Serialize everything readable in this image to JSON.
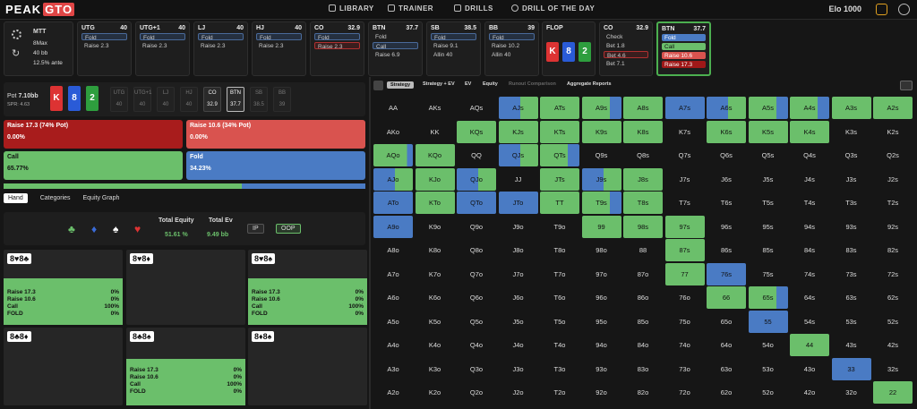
{
  "app": {
    "logo_a": "PEAK",
    "logo_b": "GTO",
    "elo": "Elo 1000"
  },
  "nav": [
    {
      "label": "LIBRARY",
      "icon": "library-icon"
    },
    {
      "label": "TRAINER",
      "icon": "trainer-icon"
    },
    {
      "label": "DRILLS",
      "icon": "drills-icon"
    },
    {
      "label": "DRILL OF THE DAY",
      "icon": "drill-day-icon"
    }
  ],
  "settings": {
    "format": "MTT",
    "max": "8Max",
    "stack": "40 bb",
    "ante": "12.5% ante"
  },
  "seats": [
    {
      "name": "UTG",
      "stack": "40",
      "actions": [
        "Fold",
        "Raise 2.3"
      ],
      "hl": 0
    },
    {
      "name": "UTG+1",
      "stack": "40",
      "actions": [
        "Fold",
        "Raise 2.3"
      ],
      "hl": 0
    },
    {
      "name": "LJ",
      "stack": "40",
      "actions": [
        "Fold",
        "Raise 2.3"
      ],
      "hl": 0
    },
    {
      "name": "HJ",
      "stack": "40",
      "actions": [
        "Fold",
        "Raise 2.3"
      ],
      "hl": 0
    },
    {
      "name": "CO",
      "stack": "32.9",
      "actions": [
        "Fold",
        "Raise 2.3"
      ],
      "hl": 1
    },
    {
      "name": "BTN",
      "stack": "37.7",
      "actions": [
        "Fold",
        "Call",
        "Raise 6.9"
      ],
      "hl": 1
    },
    {
      "name": "SB",
      "stack": "38.5",
      "actions": [
        "Fold",
        "Raise 9.1",
        "Allin 40"
      ],
      "hl": 0
    },
    {
      "name": "BB",
      "stack": "39",
      "actions": [
        "Fold",
        "Raise 10.2",
        "Allin 40"
      ],
      "hl": 0
    }
  ],
  "flop": {
    "name": "FLOP",
    "cards": [
      {
        "rank": "K",
        "color": "#d33"
      },
      {
        "rank": "8",
        "color": "#2a5bd7"
      },
      {
        "rank": "2",
        "color": "#2e9e3e"
      }
    ]
  },
  "co_seat": {
    "name": "CO",
    "stack": "32.9",
    "actions": [
      "Check",
      "Bet 1.8",
      "Bet 4.6",
      "Bet 7.1"
    ]
  },
  "btn_active": {
    "name": "BTN",
    "stack": "37.7",
    "actions": [
      "Fold",
      "Call",
      "Raise 10.6",
      "Raise 17.3"
    ]
  },
  "pot": {
    "label": "Pot",
    "value": "7.10bb",
    "spr": "SPR: 4.63",
    "board": [
      {
        "rank": "K",
        "color": "#d33"
      },
      {
        "rank": "8",
        "color": "#2a5bd7"
      },
      {
        "rank": "2",
        "color": "#2e9e3e"
      }
    ]
  },
  "positions": [
    {
      "n": "UTG",
      "v": "40"
    },
    {
      "n": "UTG+1",
      "v": "40"
    },
    {
      "n": "LJ",
      "v": "40"
    },
    {
      "n": "HJ",
      "v": "40"
    },
    {
      "n": "CO",
      "v": "32.9"
    },
    {
      "n": "BTN",
      "v": "37.7"
    },
    {
      "n": "SB",
      "v": "38.5"
    },
    {
      "n": "BB",
      "v": "39"
    }
  ],
  "actions": [
    {
      "label": "Raise 17.3 (74% Pot)",
      "pct": "0.00%",
      "color": "#a81c1c"
    },
    {
      "label": "Raise 10.6 (34% Pot)",
      "pct": "0.00%",
      "color": "#d9534f"
    },
    {
      "label": "Call",
      "pct": "65.77%",
      "color": "#6bbf6b"
    },
    {
      "label": "Fold",
      "pct": "34.23%",
      "color": "#4a7bc4"
    }
  ],
  "mix_bar": {
    "call": 65.77,
    "fold": 34.23
  },
  "hand_tabs": [
    "Hand",
    "Categories",
    "Equity Graph"
  ],
  "equity": {
    "total_equity_label": "Total Equity",
    "total_ev_label": "Total Ev",
    "total_equity": "51.61 %",
    "total_ev": "9.49 bb",
    "ip": "IP",
    "oop": "OOP"
  },
  "combos": [
    {
      "cards": "8♥8♣",
      "green": true
    },
    {
      "cards": "8♥8♦",
      "green": false
    },
    {
      "cards": "8♥8♠",
      "green": true
    },
    {
      "cards": "8♣8♦",
      "green": false
    },
    {
      "cards": "8♣8♠",
      "green": true
    },
    {
      "cards": "8♦8♠",
      "green": false
    }
  ],
  "combo_stats": [
    {
      "k": "Raise 17.3",
      "v": "0%"
    },
    {
      "k": "Raise 10.6",
      "v": "0%"
    },
    {
      "k": "Call",
      "v": "100%"
    },
    {
      "k": "FOLD",
      "v": "0%"
    }
  ],
  "grid_tabs": [
    "Strategy",
    "Strategy + EV",
    "EV",
    "Equity",
    "Runout Comparison",
    "Aggregate Reports"
  ],
  "matrix": [
    [
      "AA",
      "AKs",
      "AQs",
      "AJs",
      "ATs",
      "A9s",
      "A8s",
      "A7s",
      "A6s",
      "A5s",
      "A4s",
      "A3s",
      "A2s"
    ],
    [
      "AKo",
      "KK",
      "KQs",
      "KJs",
      "KTs",
      "K9s",
      "K8s",
      "K7s",
      "K6s",
      "K5s",
      "K4s",
      "K3s",
      "K2s"
    ],
    [
      "AQo",
      "KQo",
      "QQ",
      "QJs",
      "QTs",
      "Q9s",
      "Q8s",
      "Q7s",
      "Q6s",
      "Q5s",
      "Q4s",
      "Q3s",
      "Q2s"
    ],
    [
      "AJo",
      "KJo",
      "QJo",
      "JJ",
      "JTs",
      "J9s",
      "J8s",
      "J7s",
      "J6s",
      "J5s",
      "J4s",
      "J3s",
      "J2s"
    ],
    [
      "ATo",
      "KTo",
      "QTo",
      "JTo",
      "TT",
      "T9s",
      "T8s",
      "T7s",
      "T6s",
      "T5s",
      "T4s",
      "T3s",
      "T2s"
    ],
    [
      "A9o",
      "K9o",
      "Q9o",
      "J9o",
      "T9o",
      "99",
      "98s",
      "97s",
      "96s",
      "95s",
      "94s",
      "93s",
      "92s"
    ],
    [
      "A8o",
      "K8o",
      "Q8o",
      "J8o",
      "T8o",
      "98o",
      "88",
      "87s",
      "86s",
      "85s",
      "84s",
      "83s",
      "82s"
    ],
    [
      "A7o",
      "K7o",
      "Q7o",
      "J7o",
      "T7o",
      "97o",
      "87o",
      "77",
      "76s",
      "75s",
      "74s",
      "73s",
      "72s"
    ],
    [
      "A6o",
      "K6o",
      "Q6o",
      "J6o",
      "T6o",
      "96o",
      "86o",
      "76o",
      "66",
      "65s",
      "64s",
      "63s",
      "62s"
    ],
    [
      "A5o",
      "K5o",
      "Q5o",
      "J5o",
      "T5o",
      "95o",
      "85o",
      "75o",
      "65o",
      "55",
      "54s",
      "53s",
      "52s"
    ],
    [
      "A4o",
      "K4o",
      "Q4o",
      "J4o",
      "T4o",
      "94o",
      "84o",
      "74o",
      "64o",
      "54o",
      "44",
      "43s",
      "42s"
    ],
    [
      "A3o",
      "K3o",
      "Q3o",
      "J3o",
      "T3o",
      "93o",
      "83o",
      "73o",
      "63o",
      "53o",
      "43o",
      "33",
      "32s"
    ],
    [
      "A2o",
      "K2o",
      "Q2o",
      "J2o",
      "T2o",
      "92o",
      "82o",
      "72o",
      "62o",
      "52o",
      "42o",
      "32o",
      "22"
    ]
  ],
  "matrix_colors": [
    [
      "",
      "",
      "",
      "bg",
      "g",
      "gb",
      "g",
      "b",
      "bg",
      "gb",
      "gb",
      "g",
      "g"
    ],
    [
      "",
      "",
      "g",
      "g",
      "g",
      "g",
      "g",
      "",
      "g",
      "g",
      "g",
      "",
      ""
    ],
    [
      "gp",
      "g",
      "",
      "bg",
      "gb",
      "",
      "",
      "",
      "",
      "",
      "",
      "",
      ""
    ],
    [
      "bg",
      "g",
      "bg",
      "",
      "g",
      "bg",
      "g",
      "",
      "",
      "",
      "",
      "",
      ""
    ],
    [
      "b",
      "g",
      "b",
      "b",
      "g",
      "gb",
      "g",
      "",
      "",
      "",
      "",
      "",
      ""
    ],
    [
      "b",
      "",
      "",
      "",
      "",
      "g",
      "g",
      "g",
      "",
      "",
      "",
      "",
      ""
    ],
    [
      "",
      "",
      "",
      "",
      "",
      "",
      "",
      "g",
      "",
      "",
      "",
      "",
      ""
    ],
    [
      "",
      "",
      "",
      "",
      "",
      "",
      "",
      "g",
      "b",
      "",
      "",
      "",
      ""
    ],
    [
      "",
      "",
      "",
      "",
      "",
      "",
      "",
      "",
      "g",
      "gb",
      "",
      "",
      ""
    ],
    [
      "",
      "",
      "",
      "",
      "",
      "",
      "",
      "",
      "",
      "b",
      "",
      "",
      ""
    ],
    [
      "",
      "",
      "",
      "",
      "",
      "",
      "",
      "",
      "",
      "",
      "g",
      "",
      ""
    ],
    [
      "",
      "",
      "",
      "",
      "",
      "",
      "",
      "",
      "",
      "",
      "",
      "b",
      ""
    ],
    [
      "",
      "",
      "",
      "",
      "",
      "",
      "",
      "",
      "",
      "",
      "",
      "",
      "g"
    ]
  ]
}
